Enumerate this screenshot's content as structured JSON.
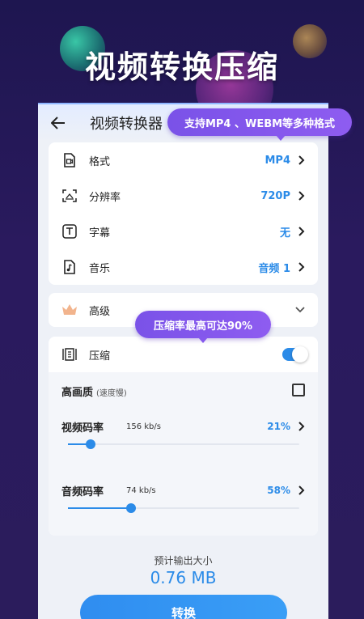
{
  "hero": {
    "title": "视频转换压缩"
  },
  "appbar": {
    "title": "视频转换器"
  },
  "tooltips": {
    "formats": "支持MP4 、WEBM等多种格式",
    "compression": "压缩率最高可达90%"
  },
  "settings": [
    {
      "icon": "video-file-icon",
      "label": "格式",
      "value": "MP4"
    },
    {
      "icon": "resolution-icon",
      "label": "分辨率",
      "value": "720P"
    },
    {
      "icon": "subtitle-icon",
      "label": "字幕",
      "value": "无"
    },
    {
      "icon": "music-icon",
      "label": "音乐",
      "value": "音频 1"
    }
  ],
  "advanced": {
    "label": "高级"
  },
  "compress": {
    "label": "压缩",
    "enabled": true,
    "high_quality": {
      "label": "高画质",
      "note": "(速度慢)",
      "checked": false
    },
    "video_rate": {
      "label": "视频码率",
      "value": "156 kb/s",
      "percent_label": "21%",
      "level": 0.21
    },
    "audio_rate": {
      "label": "音频码率",
      "value": "74 kb/s",
      "percent_label": "58%",
      "level": 0.58
    }
  },
  "output": {
    "label": "预计输出大小",
    "size": "0.76 MB"
  },
  "convert_button": "转换",
  "colors": {
    "accent": "#2b8be8",
    "tooltip": "#8558ed",
    "background": "#221a52"
  }
}
